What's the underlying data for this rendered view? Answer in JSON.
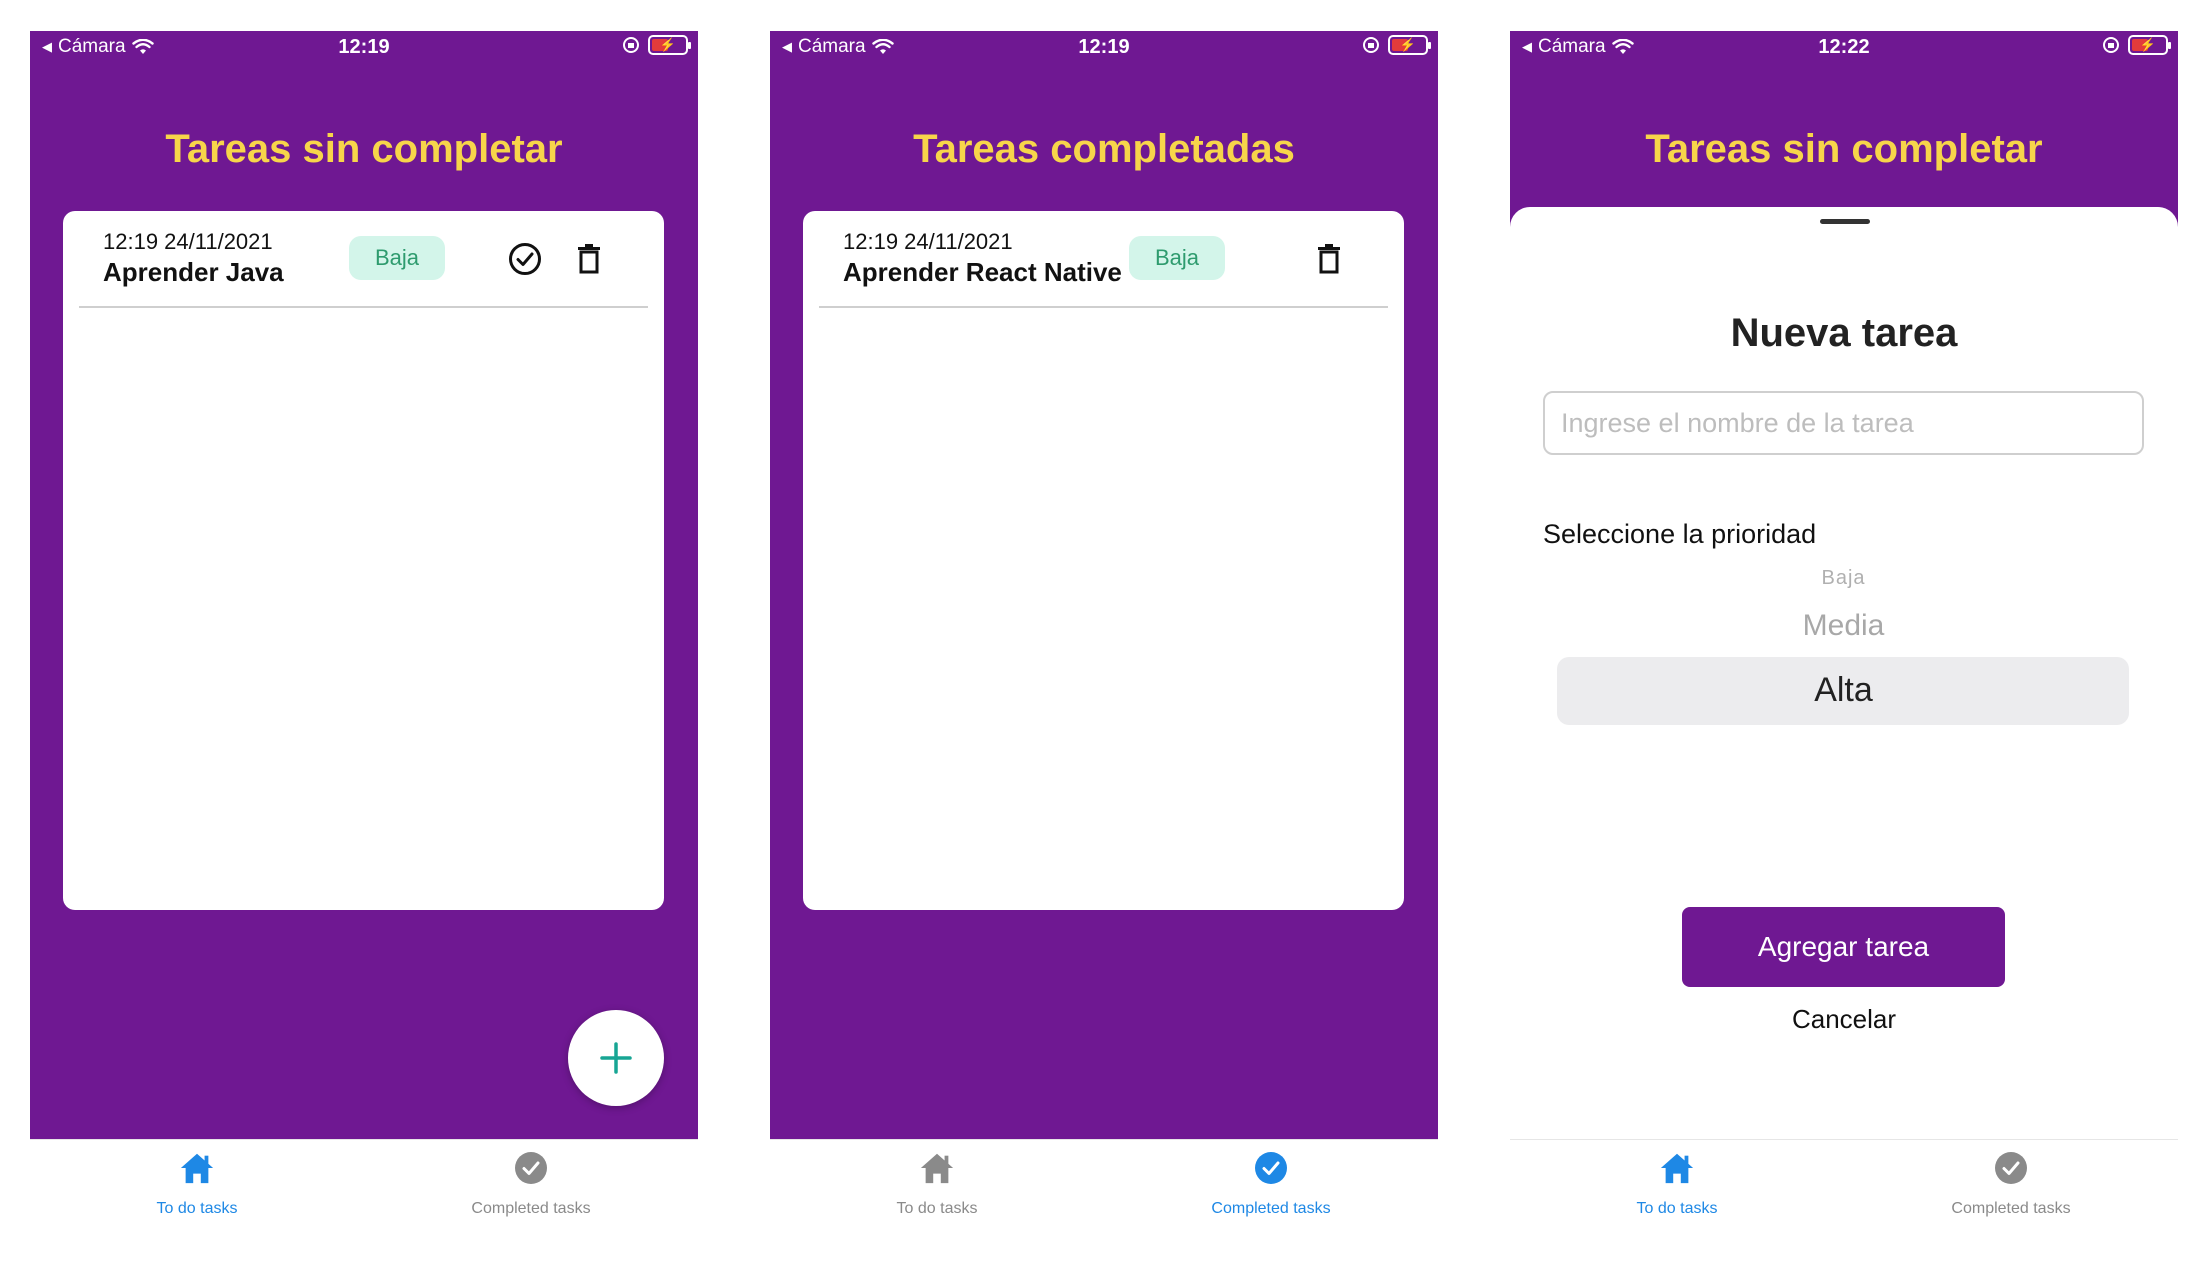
{
  "colors": {
    "purple": "#6f1892",
    "title_yellow": "#f7d54a",
    "badge_bg": "#d3f5ea",
    "badge_text": "#2e9b6e",
    "tab_active": "#1e88e5",
    "tab_inactive": "#8a8a8a",
    "fab_plus": "#17a594"
  },
  "screens": [
    {
      "status": {
        "back_app": "Cámara",
        "time": "12:19"
      },
      "title": "Tareas sin completar",
      "tasks": [
        {
          "date": "12:19 24/11/2021",
          "name": "Aprender Java",
          "priority": "Baja"
        }
      ],
      "tabs": {
        "todo": "To do tasks",
        "completed": "Completed tasks",
        "active": "todo"
      }
    },
    {
      "status": {
        "back_app": "Cámara",
        "time": "12:19"
      },
      "title": "Tareas completadas",
      "tasks": [
        {
          "date": "12:19 24/11/2021",
          "name": "Aprender React Native",
          "priority": "Baja"
        }
      ],
      "tabs": {
        "todo": "To do tasks",
        "completed": "Completed tasks",
        "active": "completed"
      }
    },
    {
      "status": {
        "back_app": "Cámara",
        "time": "12:22"
      },
      "title": "Tareas sin completar",
      "modal": {
        "title": "Nueva tarea",
        "input_placeholder": "Ingrese el nombre de la tarea",
        "input_value": "",
        "priority_label": "Seleccione la prioridad",
        "options": [
          "Baja",
          "Media",
          "Alta"
        ],
        "selected": "Alta",
        "submit": "Agregar tarea",
        "cancel": "Cancelar"
      },
      "tabs": {
        "todo": "To do tasks",
        "completed": "Completed tasks",
        "active": "todo"
      }
    }
  ]
}
